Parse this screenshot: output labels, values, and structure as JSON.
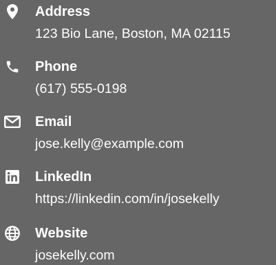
{
  "contacts": [
    {
      "icon": "map-marker-icon",
      "label": "Address",
      "value": "123 Bio Lane, Boston, MA 02115"
    },
    {
      "icon": "phone-icon",
      "label": "Phone",
      "value": "(617) 555-0198"
    },
    {
      "icon": "envelope-icon",
      "label": "Email",
      "value": "jose.kelly@example.com"
    },
    {
      "icon": "linkedin-icon",
      "label": "LinkedIn",
      "value": "https://linkedin.com/in/josekelly"
    },
    {
      "icon": "globe-icon",
      "label": "Website",
      "value": "josekelly.com"
    }
  ],
  "colors": {
    "background": "#666666",
    "text": "#ffffff"
  }
}
